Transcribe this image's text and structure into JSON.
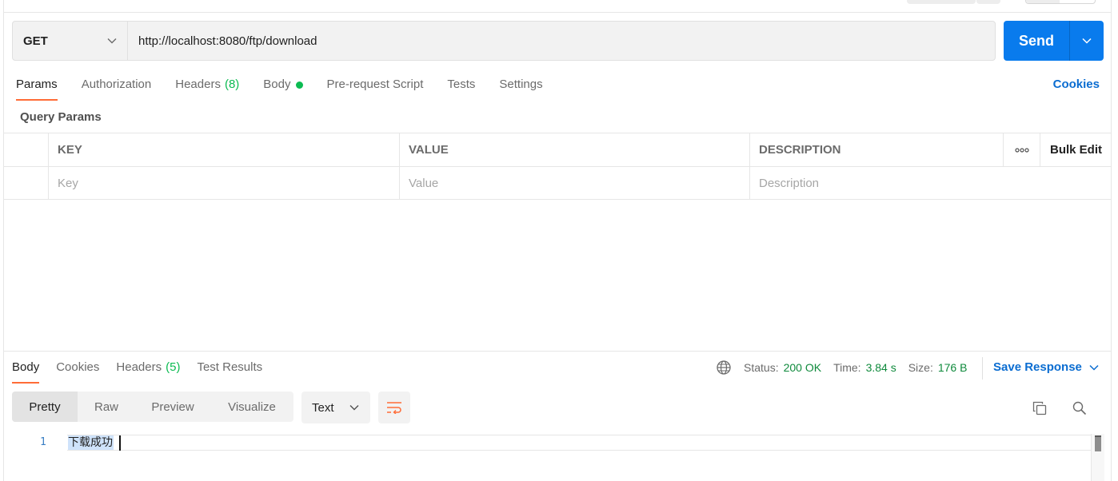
{
  "request": {
    "method": "GET",
    "url": "http://localhost:8080/ftp/download",
    "send_label": "Send"
  },
  "request_tabs": [
    {
      "label": "Params",
      "active": true
    },
    {
      "label": "Authorization"
    },
    {
      "label": "Headers",
      "count": "(8)"
    },
    {
      "label": "Body"
    },
    {
      "label": "Pre-request Script"
    },
    {
      "label": "Tests"
    },
    {
      "label": "Settings"
    }
  ],
  "cookies_link": "Cookies",
  "query_params": {
    "title": "Query Params",
    "columns": [
      "KEY",
      "VALUE",
      "DESCRIPTION"
    ],
    "more_label": "ooo",
    "bulk_edit": "Bulk Edit",
    "placeholders": {
      "key": "Key",
      "value": "Value",
      "description": "Description"
    }
  },
  "response": {
    "tabs": [
      {
        "label": "Body",
        "active": true
      },
      {
        "label": "Cookies"
      },
      {
        "label": "Headers",
        "count": "(5)"
      },
      {
        "label": "Test Results"
      }
    ],
    "status_label": "Status:",
    "status_value": "200 OK",
    "time_label": "Time:",
    "time_value": "3.84 s",
    "size_label": "Size:",
    "size_value": "176 B",
    "save_label": "Save Response",
    "views": [
      "Pretty",
      "Raw",
      "Preview",
      "Visualize"
    ],
    "format": "Text",
    "line_number": "1",
    "body_text": "下载成功"
  },
  "colors": {
    "accent": "#097bed",
    "tab_indicator": "#ff6c37",
    "success": "#0cbb52",
    "link": "#0b6dd1"
  },
  "icons": [
    "chevron-down-icon",
    "globe-icon",
    "wrap-icon",
    "copy-icon",
    "search-icon"
  ]
}
